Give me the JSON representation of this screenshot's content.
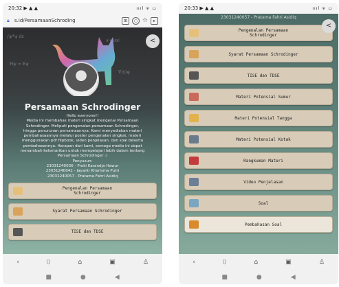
{
  "left": {
    "status": {
      "time": "20:32",
      "indicators": "▶ ▲ ▲",
      "right": "ıııl ᯤ ▭"
    },
    "browser": {
      "url": "s.id/PersamaanSchroding"
    },
    "page": {
      "title": "Persamaan Schrodinger",
      "intro_lines": [
        "Hello everyone!!",
        "Media ini membahas materi singkat mengenai Persamaan",
        "Schrodinger. Meliputi pengenalan persamaan Schrodinger,",
        "hingga penurunan persamaannya. Kami menyediakan materi",
        "pembahasaannya melalui poster pengenalan singkat, materi",
        "menggunakan pdf flipbook, video penjelasan, dan soal beserta",
        "pembahasannya. Harapan dari kami, semoga media ini dapat",
        "menambah ketertarikan untuk mempelajari lebih dalam tentang",
        "Persamaan Schrodinger :)",
        "Penyusun:",
        "23031240036 - Proki Karandja Hawur",
        "23031240042 - Jayanti Kharisma Putri",
        "23031240057 - Pratama Fahri Asidiq"
      ],
      "buttons": [
        {
          "label": "Pengenalan Persamaan\nSchrodinger",
          "icon": "poster-icon",
          "color": "#e6c07a"
        },
        {
          "label": "Syarat Persamaan Schrodinger",
          "icon": "book-icon",
          "color": "#d9a35a"
        },
        {
          "label": "TISE dan TDSE",
          "icon": "pen-icon",
          "color": "#555555"
        }
      ]
    }
  },
  "right": {
    "status": {
      "time": "20:33",
      "indicators": "▶ ▲ ▲",
      "right": "ıııl ᯤ ▭"
    },
    "header": "23031240057 - Pratama Fahri Asidiq",
    "buttons": [
      {
        "label": "Pengenalan Persamaan\nSchrodinger",
        "icon": "poster-icon",
        "color": "#e6c07a"
      },
      {
        "label": "Syarat Persamaan Schrodinger",
        "icon": "book-icon",
        "color": "#d9a35a"
      },
      {
        "label": "TISE dan TDSE",
        "icon": "pen-icon",
        "color": "#555555"
      },
      {
        "label": "Materi Potensial Sumur",
        "icon": "slides-icon",
        "color": "#c96a5a"
      },
      {
        "label": "Materi Potensial Tangga",
        "icon": "folder-icon",
        "color": "#e3b24a"
      },
      {
        "label": "Materi Potensial Kotak",
        "icon": "notebook-icon",
        "color": "#6b7b8c"
      },
      {
        "label": "Rangkuman Materi",
        "icon": "summary-icon",
        "color": "#c43a3a"
      },
      {
        "label": "Video Penjelasan",
        "icon": "video-icon",
        "color": "#6d7f96"
      },
      {
        "label": "Soal",
        "icon": "quiz-icon",
        "color": "#7aa6c2"
      },
      {
        "label": "Pembahasan Soal",
        "icon": "discussion-icon",
        "color": "#d98a2b"
      }
    ]
  },
  "nav": {
    "back": "‹",
    "bookmarks": "⌷",
    "home": "⌂",
    "tabs": "▣",
    "profile": "♙",
    "sys_menu": "■",
    "sys_home": "●",
    "sys_back": "◀"
  },
  "share_glyph": "<"
}
